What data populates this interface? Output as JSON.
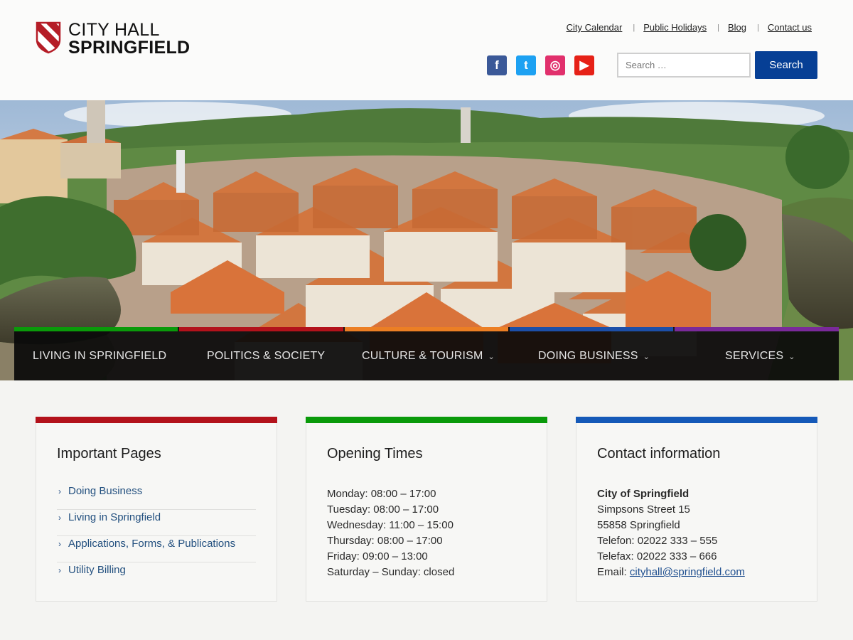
{
  "logo": {
    "line1": "CITY HALL",
    "line2": "SPRINGFIELD"
  },
  "toplinks": [
    "City Calendar",
    "Public Holidays",
    "Blog",
    "Contact us"
  ],
  "social": [
    {
      "icon": "facebook-icon",
      "glyph": "f",
      "color": "#3b5998"
    },
    {
      "icon": "twitter-icon",
      "glyph": "t",
      "color": "#1da1f2"
    },
    {
      "icon": "instagram-icon",
      "glyph": "◎",
      "color": "#e1306c"
    },
    {
      "icon": "youtube-icon",
      "glyph": "▶",
      "color": "#e62117"
    }
  ],
  "search": {
    "placeholder": "Search …",
    "button": "Search"
  },
  "nav": [
    {
      "label": "LIVING IN SPRINGFIELD",
      "color": "#0a9a0a",
      "dropdown": false
    },
    {
      "label": "POLITICS & SOCIETY",
      "color": "#b3121b",
      "dropdown": false
    },
    {
      "label": "CULTURE & TOURISM",
      "color": "#ec7f24",
      "dropdown": true
    },
    {
      "label": "DOING BUSINESS",
      "color": "#1c4fa8",
      "dropdown": true
    },
    {
      "label": "SERVICES",
      "color": "#7a2a9a",
      "dropdown": true
    }
  ],
  "cards": {
    "important": {
      "title": "Important Pages",
      "color": "#b3121b",
      "links": [
        "Doing Business",
        "Living in Springfield",
        "Applications, Forms, & Publications",
        "Utility Billing"
      ]
    },
    "opening": {
      "title": "Opening Times",
      "color": "#0a9a0a",
      "lines": [
        "Monday: 08:00 – 17:00",
        "Tuesday: 08:00 – 17:00",
        "Wednesday: 11:00 – 15:00",
        "Thursday: 08:00 – 17:00",
        "Friday: 09:00 – 13:00",
        "Saturday – Sunday: closed"
      ]
    },
    "contact": {
      "title": "Contact information",
      "color": "#1559b8",
      "name": "City of Springfield",
      "street": "Simpsons Street 15",
      "city": "55858 Springfield",
      "phone": "Telefon: 02022 333 – 555",
      "fax": "Telefax: 02022 333 – 666",
      "email_label": "Email:",
      "email": "cityhall@springfield.com"
    }
  }
}
